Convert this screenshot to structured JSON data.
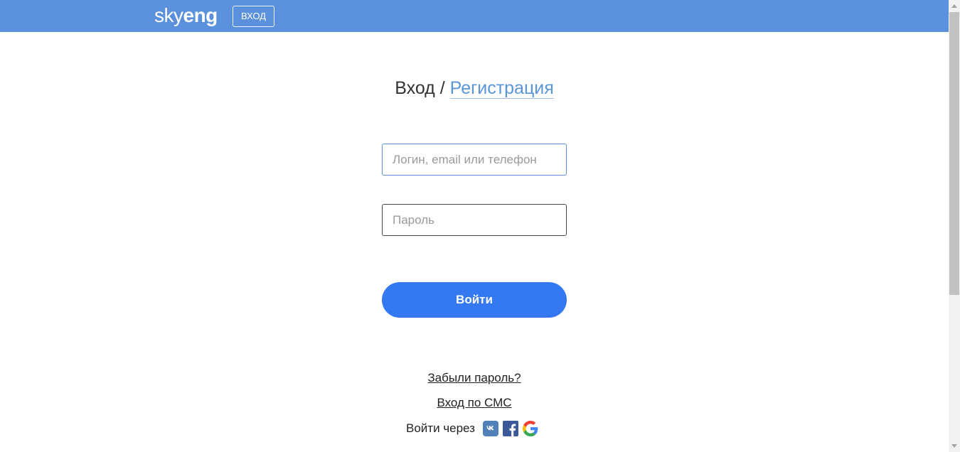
{
  "header": {
    "logo_light": "sky",
    "logo_bold": "eng",
    "login_button": "ВХОД",
    "background_color": "#5a90dc"
  },
  "title": {
    "login": "Вход",
    "separator": " / ",
    "register": "Регистрация"
  },
  "form": {
    "login_placeholder": "Логин, email или телефон",
    "password_placeholder": "Пароль",
    "submit_label": "Войти",
    "submit_color": "#3478f2"
  },
  "links": {
    "forgot_password": "Забыли пароль?",
    "sms_login": "Вход по СМС",
    "social_label": "Войти через"
  },
  "social_icons": [
    "vk-icon",
    "facebook-icon",
    "google-icon"
  ]
}
